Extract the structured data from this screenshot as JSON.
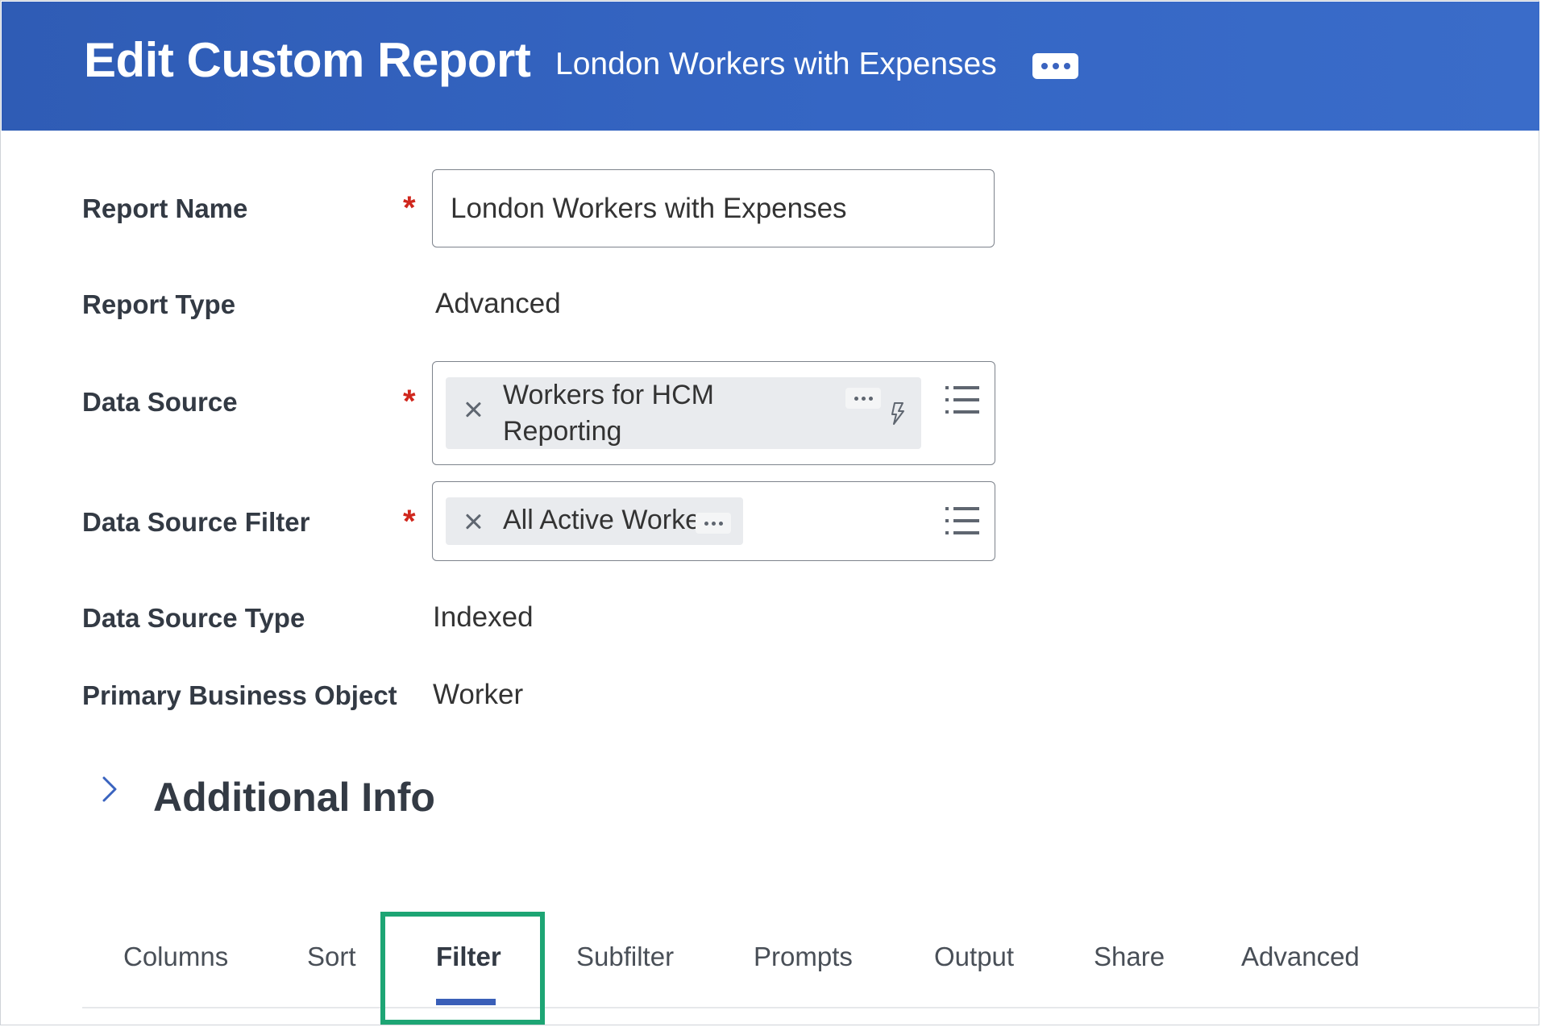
{
  "header": {
    "title": "Edit Custom Report",
    "report_name": "London Workers with Expenses",
    "more_icon": "ellipsis-icon",
    "background_color": "#3566c4"
  },
  "form": {
    "report_name": {
      "label": "Report Name",
      "required": "*",
      "value": "London Workers with Expenses"
    },
    "report_type": {
      "label": "Report Type",
      "value": "Advanced"
    },
    "data_source": {
      "label": "Data Source",
      "required": "*",
      "selected_line1": "Workers for HCM",
      "selected_line2": "Reporting",
      "remove_icon": "close-icon",
      "more_icon": "ellipsis-icon",
      "indexed_icon": "lightning-icon",
      "prompt_icon": "list-icon"
    },
    "data_source_filter": {
      "label": "Data Source Filter",
      "required": "*",
      "selected": "All Active Workers",
      "remove_icon": "close-icon",
      "more_icon": "ellipsis-icon",
      "prompt_icon": "list-icon"
    },
    "data_source_type": {
      "label": "Data Source Type",
      "value": "Indexed"
    },
    "primary_business_object": {
      "label": "Primary Business Object",
      "value": "Worker"
    }
  },
  "additional_info": {
    "title": "Additional Info",
    "icon": "chevron-right-icon",
    "expanded": false
  },
  "tabs": {
    "items": [
      {
        "label": "Columns"
      },
      {
        "label": "Sort"
      },
      {
        "label": "Filter",
        "active": true
      },
      {
        "label": "Subfilter"
      },
      {
        "label": "Prompts"
      },
      {
        "label": "Output"
      },
      {
        "label": "Share"
      },
      {
        "label": "Advanced"
      }
    ],
    "active_color": "#3a5fb8",
    "highlight_color": "#1da574"
  }
}
